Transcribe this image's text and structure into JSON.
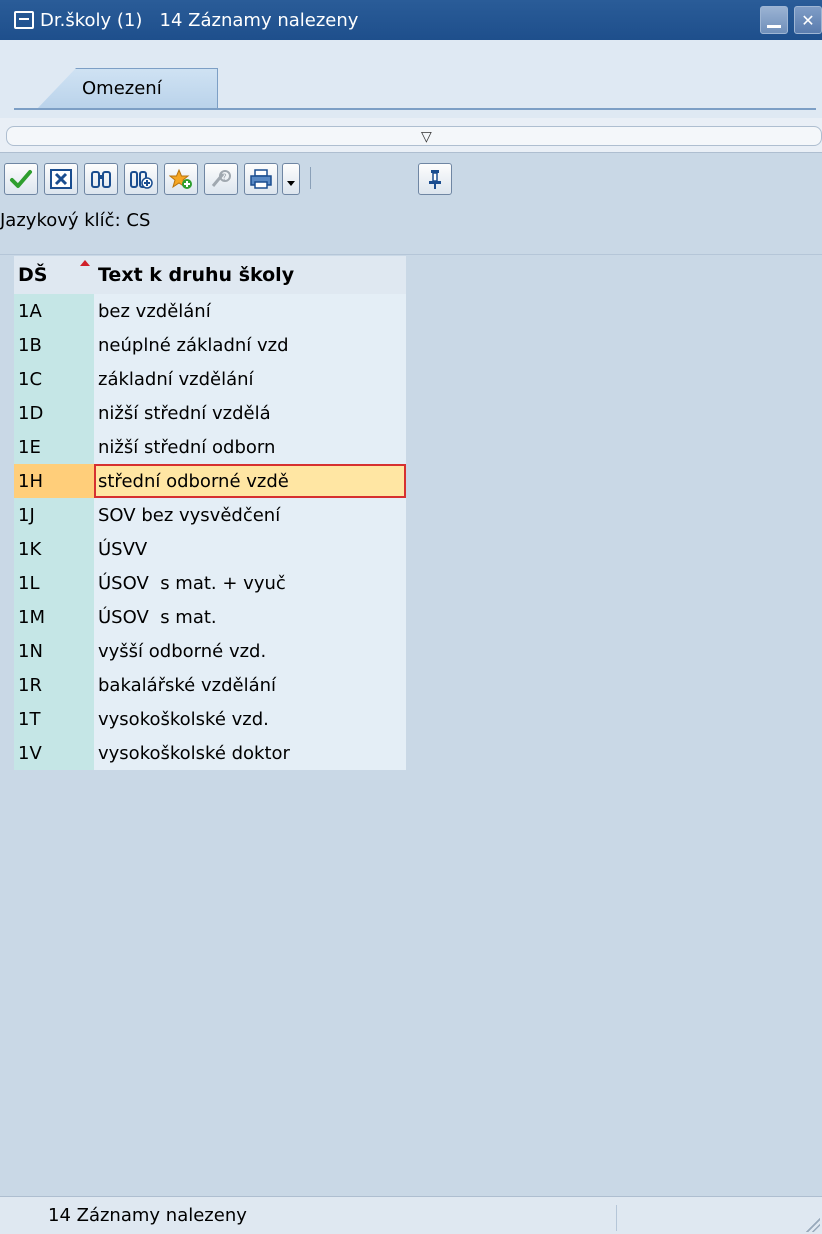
{
  "window": {
    "title": "Dr.školy (1)   14 Záznamy nalezeny"
  },
  "tabs": [
    {
      "label": "Omezení",
      "active": true
    }
  ],
  "toolbar": {
    "buttons": [
      "checkmark-icon",
      "cancel-icon",
      "find-icon",
      "find-next-icon",
      "favorites-add-icon",
      "help-icon",
      "print-icon",
      "print-dropdown-icon",
      "pin-icon"
    ]
  },
  "language_key_label": "Jazykový klíč: CS",
  "table": {
    "columns": [
      "DŠ",
      "Text k druhu školy"
    ],
    "rows": [
      {
        "code": "1A",
        "text": "bez vzdělání"
      },
      {
        "code": "1B",
        "text": "neúplné základní vzd"
      },
      {
        "code": "1C",
        "text": "základní vzdělání"
      },
      {
        "code": "1D",
        "text": "nižší střední vzdělá"
      },
      {
        "code": "1E",
        "text": "nižší střední odborn"
      },
      {
        "code": "1H",
        "text": "střední odborné vzdě",
        "selected": true
      },
      {
        "code": "1J",
        "text": "SOV bez vysvědčení"
      },
      {
        "code": "1K",
        "text": "ÚSVV"
      },
      {
        "code": "1L",
        "text": "ÚSOV  s mat. + vyuč"
      },
      {
        "code": "1M",
        "text": "ÚSOV  s mat."
      },
      {
        "code": "1N",
        "text": "vyšší odborné vzd."
      },
      {
        "code": "1R",
        "text": "bakalářské vzdělání"
      },
      {
        "code": "1T",
        "text": "vysokoškolské vzd."
      },
      {
        "code": "1V",
        "text": "vysokoškolské doktor"
      }
    ]
  },
  "status": {
    "text": "14 Záznamy nalezeny"
  },
  "colors": {
    "titlebar": "#1e4f8c",
    "selected_row": "#ffe6a3",
    "code_column": "#c5e6e6"
  }
}
